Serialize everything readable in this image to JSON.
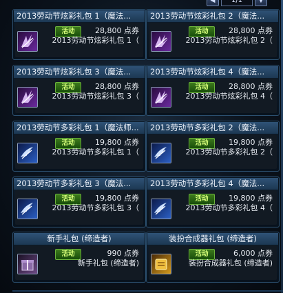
{
  "pager": {
    "page": "1/1",
    "prev_icon": "triangle-left",
    "next_icon": "triangle-down"
  },
  "colors": {
    "card_border": "#2b4f6f",
    "title_bar": "#2f5276",
    "badge": "#3d7a1c",
    "badge_text": "#d8ff7a"
  },
  "items": [
    {
      "title": "2013劳动节炫彩礼包 1（魔法...",
      "badge": "活动",
      "price": "28,800 点券",
      "name": "2013劳动节炫彩礼包 1（",
      "icon": "purple-wing-icon"
    },
    {
      "title": "2013劳动节炫彩礼包 2（魔法...",
      "badge": "活动",
      "price": "28,800 点券",
      "name": "2013劳动节炫彩礼包 2（",
      "icon": "purple-wing-icon"
    },
    {
      "title": "2013劳动节炫彩礼包 3（魔法...",
      "badge": "活动",
      "price": "28,800 点券",
      "name": "2013劳动节炫彩礼包 3（",
      "icon": "purple-wing-icon"
    },
    {
      "title": "2013劳动节炫彩礼包 4（魔法...",
      "badge": "活动",
      "price": "28,800 点券",
      "name": "2013劳动节炫彩礼包 4（",
      "icon": "purple-wing-icon"
    },
    {
      "title": "2013劳动节多彩礼包 1（魔法师...",
      "badge": "活动",
      "price": "19,800 点券",
      "name": "2013劳动节多彩礼包 1（",
      "icon": "blue-wing-icon"
    },
    {
      "title": "2013劳动节多彩礼包 2（魔法...",
      "badge": "活动",
      "price": "19,800 点券",
      "name": "2013劳动节多彩礼包 2（",
      "icon": "blue-wing-icon"
    },
    {
      "title": "2013劳动节多彩礼包 3（魔法...",
      "badge": "活动",
      "price": "19,800 点券",
      "name": "2013劳动节多彩礼包 3（",
      "icon": "blue-wing-icon"
    },
    {
      "title": "2013劳动节多彩礼包 4（魔法...",
      "badge": "活动",
      "price": "19,800 点券",
      "name": "2013劳动节多彩礼包 4（",
      "icon": "blue-wing-icon"
    },
    {
      "title": "新手礼包 (缔造者)",
      "badge": "活动",
      "price": "990 点券",
      "name": "新手礼包 (缔造者)",
      "icon": "gift-box-icon"
    },
    {
      "title": "装扮合成器礼包 (缔造者)",
      "badge": "活动",
      "price": "6,000 点券",
      "name": "装扮合成器礼包 (缔造者)",
      "icon": "gold-box-icon"
    }
  ]
}
